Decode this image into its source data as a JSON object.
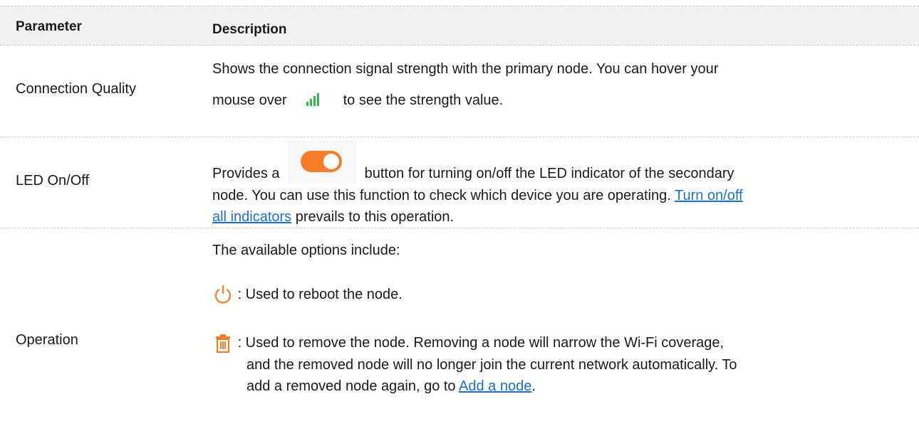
{
  "table": {
    "header": {
      "parameter": "Parameter",
      "description": "Description"
    },
    "connection_quality": {
      "parameter": "Connection Quality",
      "line1": "Shows the connection signal strength with the primary node. You can hover your",
      "line2_pre": "mouse over",
      "line2_post": "to see the strength value.",
      "icon": "signal-bars-icon",
      "icon_color": "#2dbd4e"
    },
    "led": {
      "parameter": "LED On/Off",
      "line1_pre": "Provides a",
      "line1_post": "button for turning on/off the LED indicator of the secondary",
      "line2": "node. You can use this function to check which device you are operating.",
      "link": "Turn on/off all indicators",
      "link_part1": "Turn on/off",
      "link_part2": "all indicators",
      "line3_post": "prevails to this operation.",
      "icon": "toggle-switch-icon",
      "icon_color": "#f57c28"
    },
    "operation": {
      "parameter": "Operation",
      "intro": "The available options include:",
      "reboot_text": ": Used to reboot the node.",
      "reboot_icon": "power-icon",
      "remove_line1": ": Used to remove the node. Removing a node will narrow the Wi-Fi coverage,",
      "remove_line2": "and the removed node will no longer join the current network automatically. To",
      "remove_line3_pre": "add a removed node again, go to",
      "remove_link": "Add a node",
      "remove_line3_post": ".",
      "remove_icon": "trash-icon",
      "icon_color": "#f57c28"
    }
  }
}
